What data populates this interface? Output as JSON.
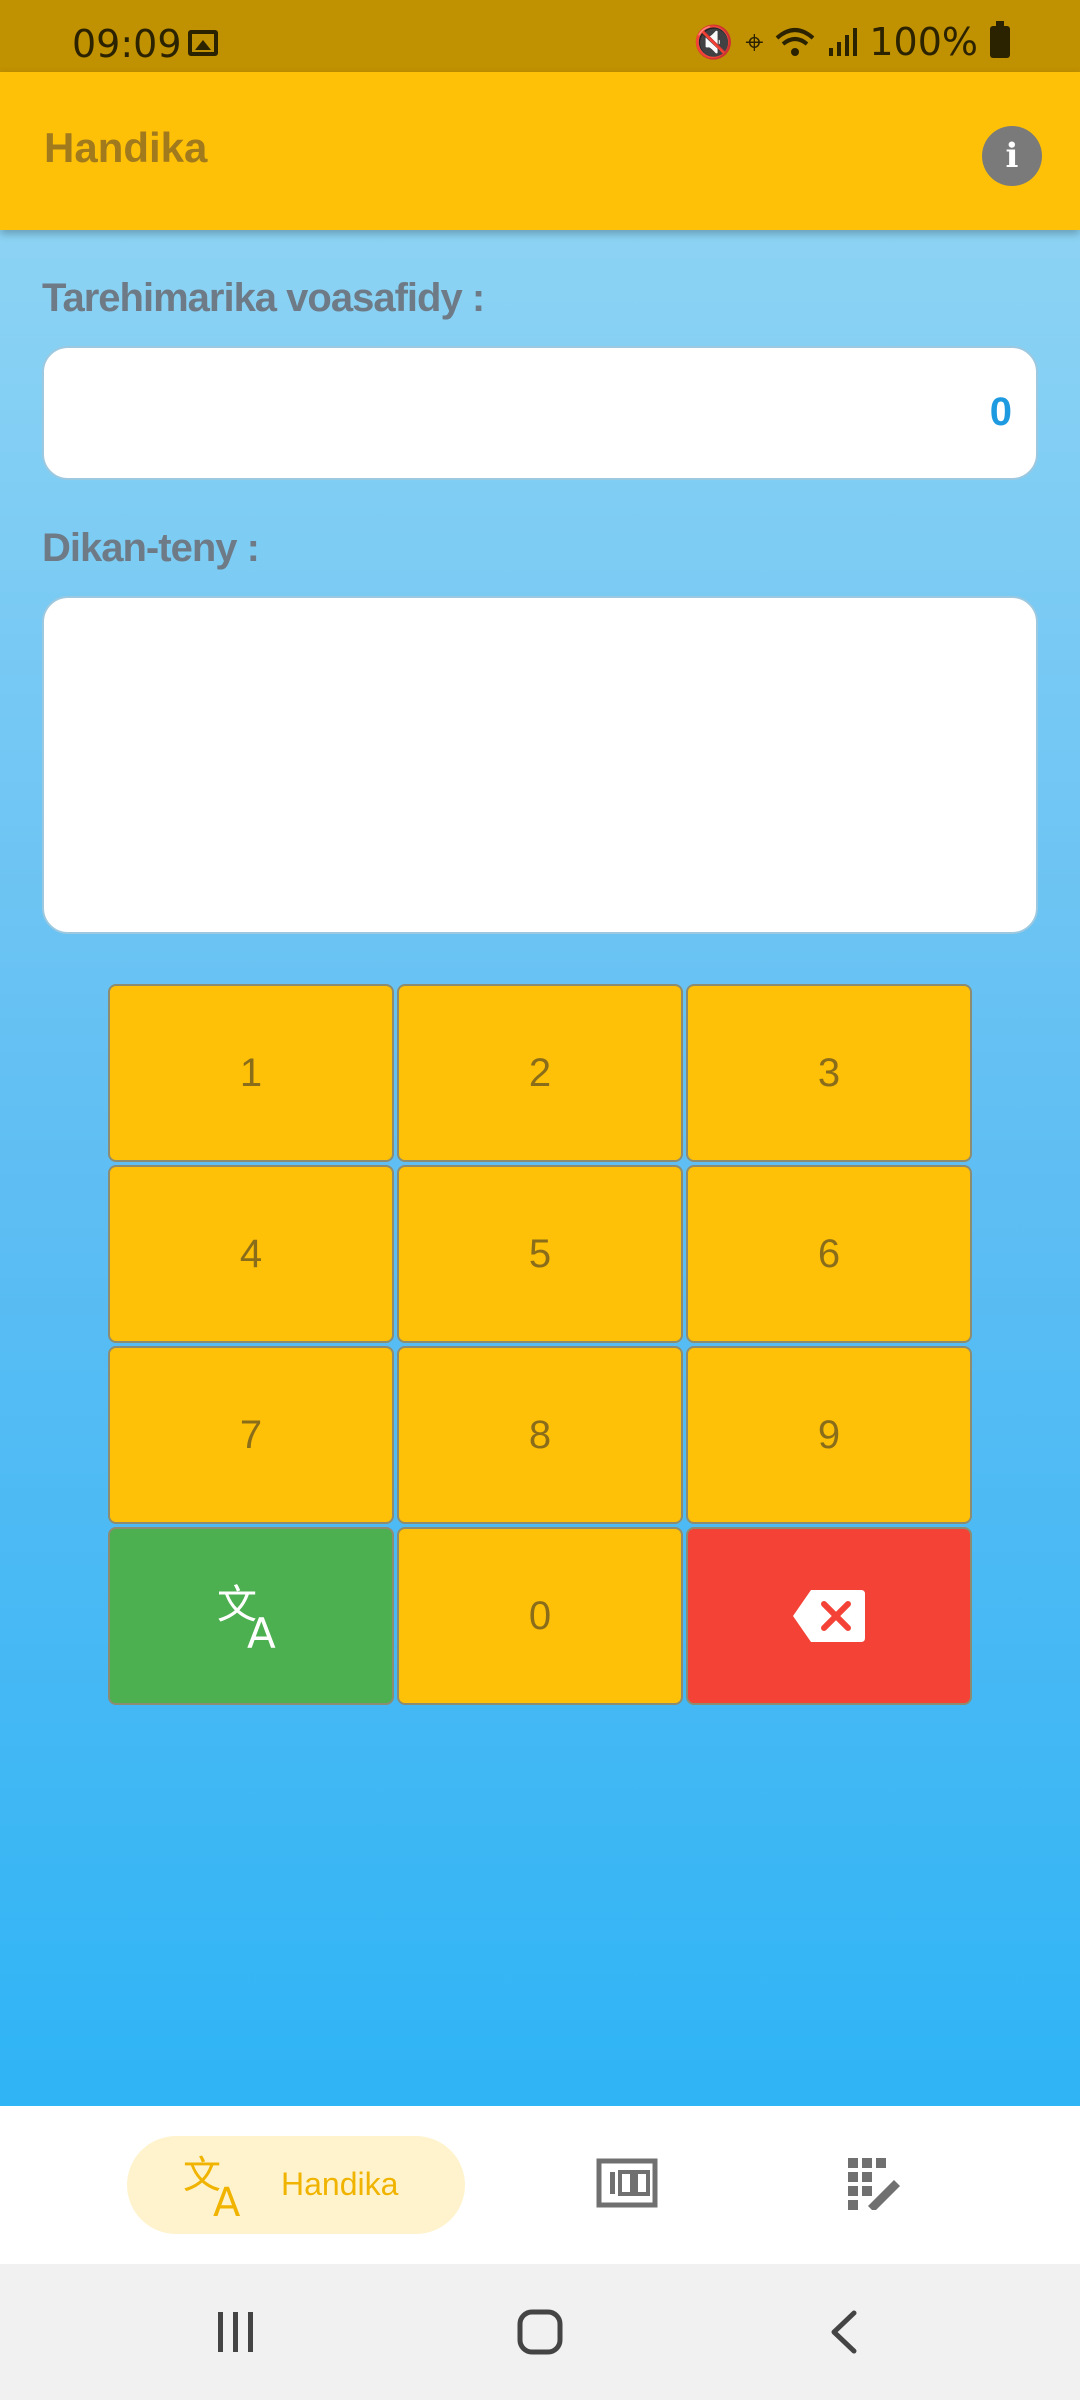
{
  "status_bar": {
    "time": "09:09",
    "battery": "100%",
    "icons": [
      "gallery-icon",
      "mute-icon",
      "location-icon",
      "wifi-icon",
      "signal-icon",
      "battery-icon"
    ]
  },
  "app_bar": {
    "title": "Handika",
    "info_label": "i"
  },
  "form": {
    "number_label": "Tarehimarika voasafidy :",
    "number_value": "0",
    "text_label": "Dikan-teny :",
    "text_value": ""
  },
  "keypad": {
    "keys": [
      "1",
      "2",
      "3",
      "4",
      "5",
      "6",
      "7",
      "8",
      "9",
      "",
      "0",
      ""
    ],
    "translate_icon": "translate-icon",
    "backspace_icon": "backspace-icon"
  },
  "bottom_nav": {
    "active_label": "Handika",
    "items": [
      "translate-icon",
      "numbers-icon",
      "edit-grid-icon"
    ]
  },
  "colors": {
    "status_bar": "#C09100",
    "app_bar": "#FFC107",
    "key": "#FFC107",
    "translate_key": "#4CAF50",
    "delete_key": "#F44336",
    "accent_text": "#1E9BE0"
  }
}
